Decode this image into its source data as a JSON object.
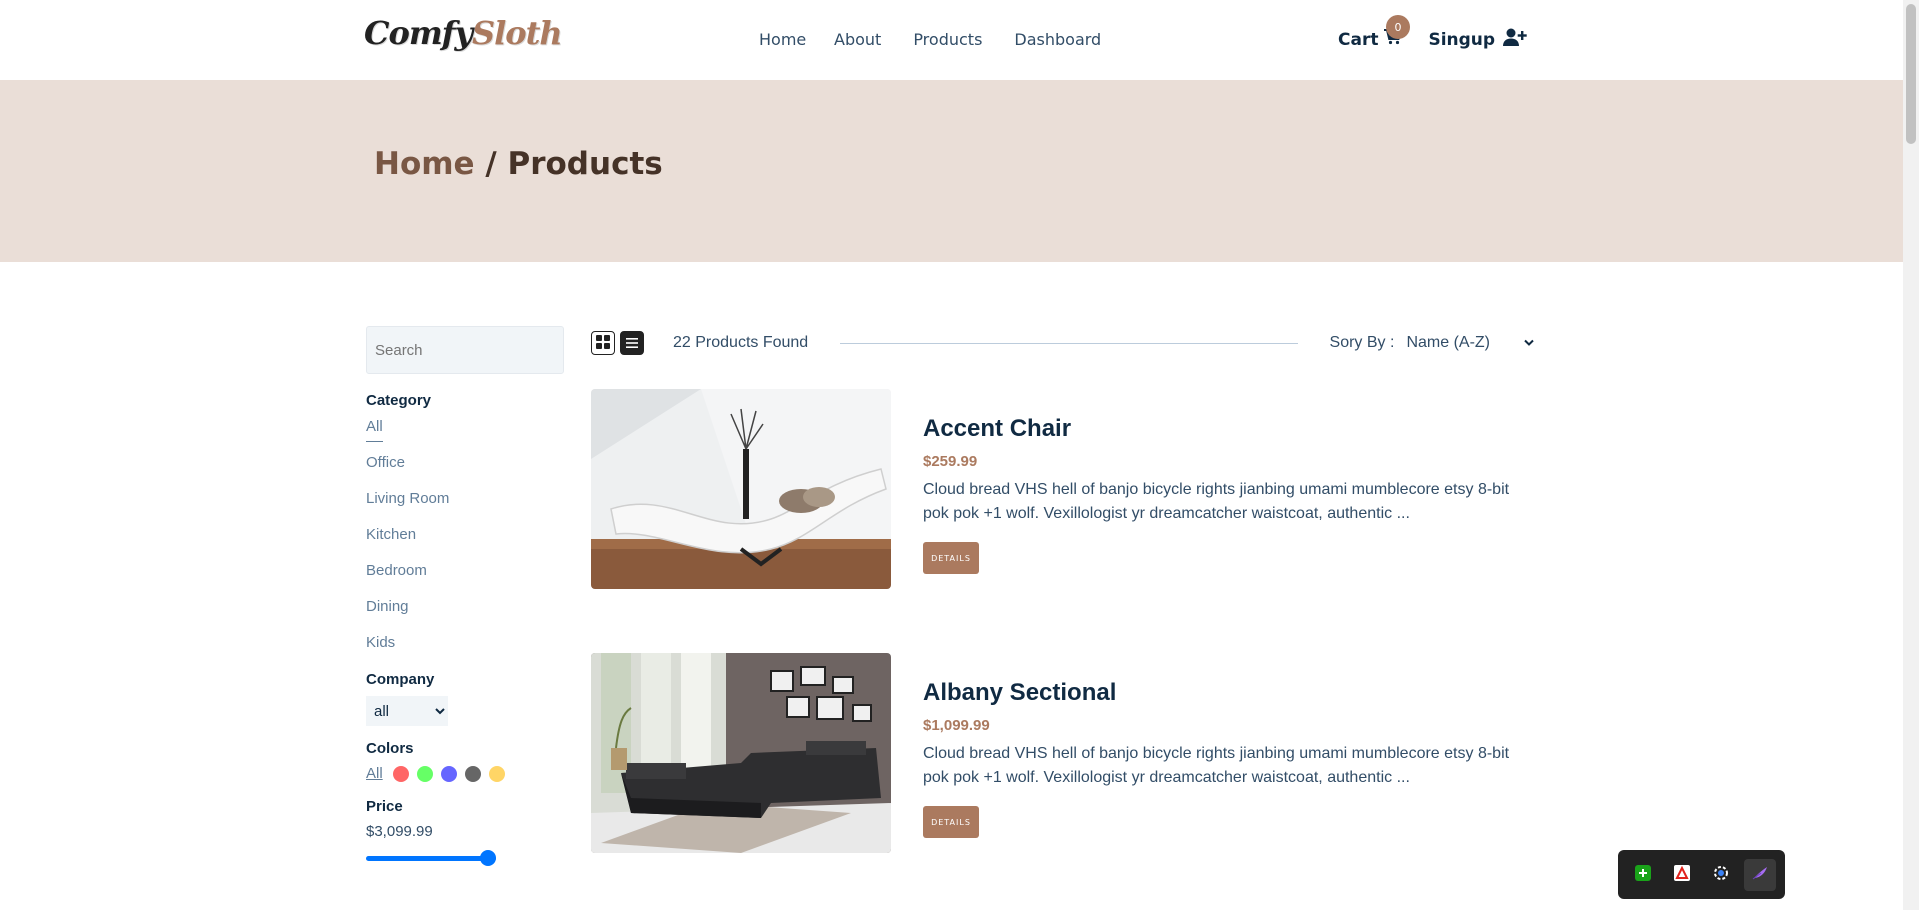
{
  "nav": {
    "logo_part1": "Comfy",
    "logo_part2": "Sloth",
    "links": [
      "Home",
      "About",
      "Products",
      "Dashboard"
    ],
    "cart_label": "Cart",
    "cart_count": "0",
    "signup_label": "Singup"
  },
  "hero": {
    "home": "Home",
    "separator": " / ",
    "current": "Products"
  },
  "filters": {
    "search_placeholder": "Search",
    "category_title": "Category",
    "categories": [
      "All",
      "Office",
      "Living Room",
      "Kitchen",
      "Bedroom",
      "Dining",
      "Kids"
    ],
    "company_title": "Company",
    "company_selected": "all",
    "colors_title": "Colors",
    "colors_all": "All",
    "colors": [
      "#ff0000",
      "#00ff00",
      "#0000ff",
      "#000000",
      "#ffb900"
    ],
    "price_title": "Price",
    "price_value": "$3,099.99",
    "price_fraction": 1.0
  },
  "products_header": {
    "count_text": "22 Products Found",
    "sort_label": "Sory By :",
    "sort_selected": "Name (A-Z)"
  },
  "products": [
    {
      "name": "Accent Chair",
      "price": "$259.99",
      "description": "Cloud bread VHS hell of banjo bicycle rights jianbing umami mumblecore etsy 8-bit pok pok +1 wolf. Vexillologist yr dreamcatcher waistcoat, authentic ...",
      "button": "DETAILS"
    },
    {
      "name": "Albany Sectional",
      "price": "$1,099.99",
      "description": "Cloud bread VHS hell of banjo bicycle rights jianbing umami mumblecore etsy 8-bit pok pok +1 wolf. Vexillologist yr dreamcatcher waistcoat, authentic ...",
      "button": "DETAILS"
    }
  ],
  "colors": {
    "accent": "#ab7a5f",
    "hero_bg": "#eaded7",
    "heading": "#102a42"
  }
}
